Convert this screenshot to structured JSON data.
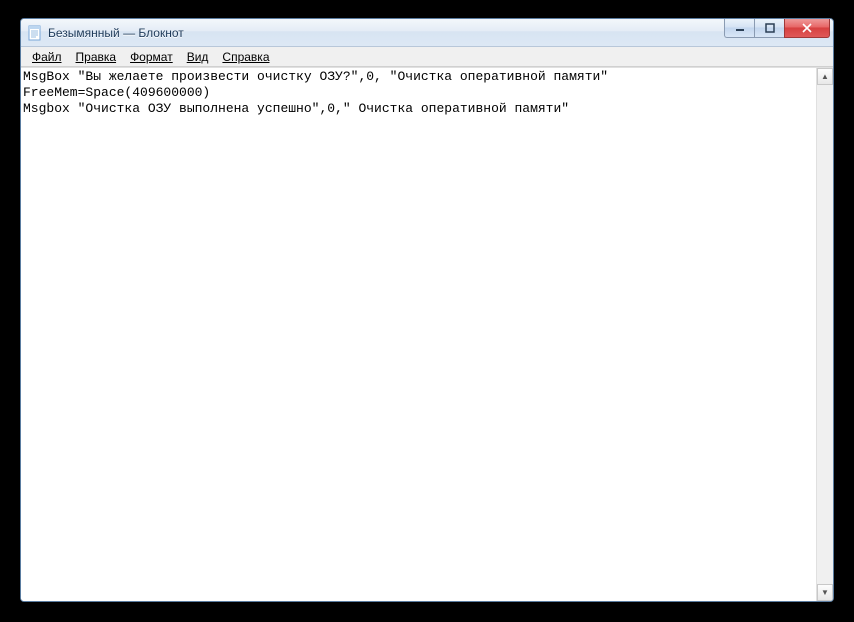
{
  "window": {
    "title": "Безымянный — Блокнот"
  },
  "menu": {
    "file": "Файл",
    "edit": "Правка",
    "format": "Формат",
    "view": "Вид",
    "help": "Справка"
  },
  "editor": {
    "content": "MsgBox \"Вы желаете произвести очистку ОЗУ?\",0, \"Очистка оперативной памяти\"\nFreeMem=Space(409600000)\nMsgbox \"Очистка ОЗУ выполнена успешно\",0,\" Очистка оперативной памяти\""
  },
  "scroll": {
    "up": "▲",
    "down": "▼"
  }
}
